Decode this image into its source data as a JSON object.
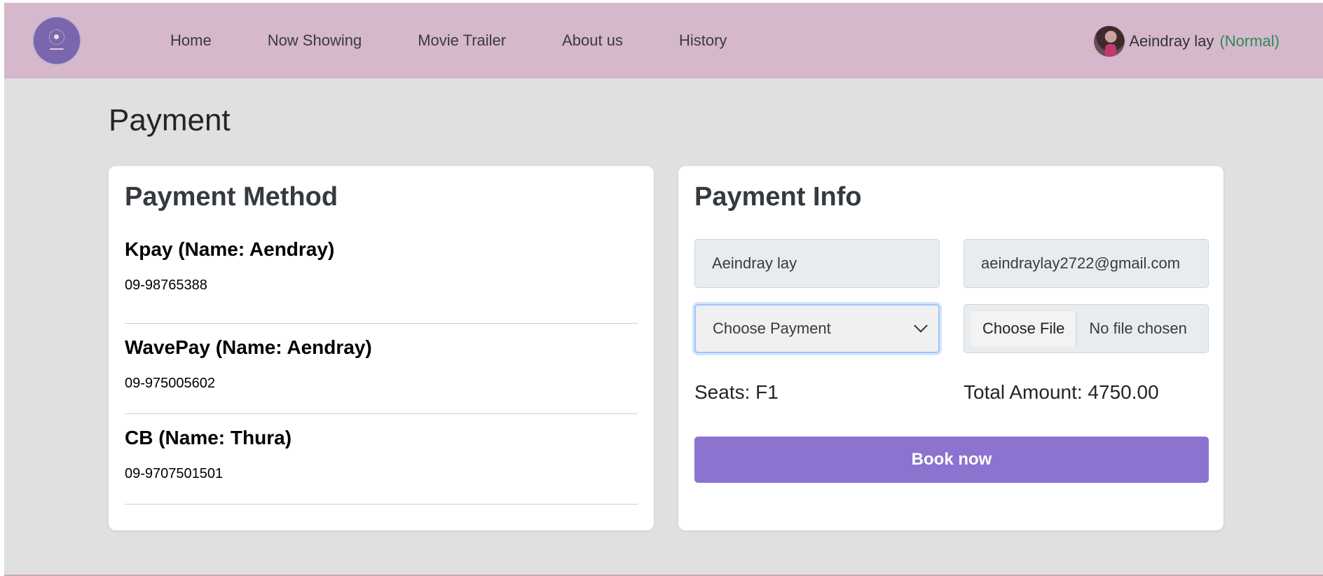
{
  "nav": {
    "links": [
      "Home",
      "Now Showing",
      "Movie Trailer",
      "About us",
      "History"
    ]
  },
  "user": {
    "name": "Aeindray lay",
    "role": "(Normal)"
  },
  "page": {
    "title": "Payment"
  },
  "payment_method": {
    "title": "Payment Method",
    "items": [
      {
        "name": "Kpay (Name: Aendray)",
        "phone": "09-98765388"
      },
      {
        "name": "WavePay (Name: Aendray)",
        "phone": "09-975005602"
      },
      {
        "name": "CB (Name: Thura)",
        "phone": "09-9707501501"
      }
    ]
  },
  "payment_info": {
    "title": "Payment Info",
    "name_value": "Aeindray lay",
    "email_value": "aeindraylay2722@gmail.com",
    "payment_select": "Choose Payment",
    "file_button": "Choose File",
    "file_status": "No file chosen",
    "seats": "Seats: F1",
    "total": "Total Amount: 4750.00",
    "book_label": "Book now"
  },
  "colors": {
    "navbar": "#d5b8cc",
    "accent": "#8c73cf",
    "logo": "#7a66ad",
    "role": "#2e8b57",
    "background": "#e0e0e0"
  }
}
